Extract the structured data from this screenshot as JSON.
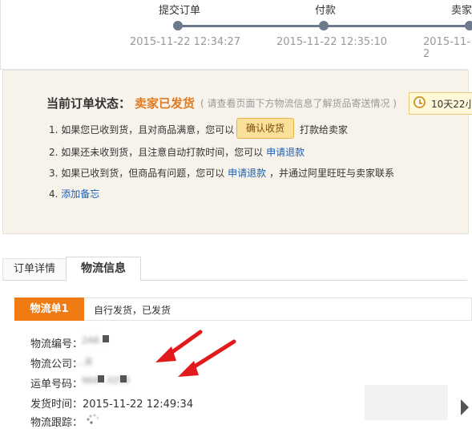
{
  "progress": {
    "steps": [
      {
        "label": "提交订单",
        "time": "2015-11-22 12:34:27"
      },
      {
        "label": "付款",
        "time": "2015-11-22 12:35:10"
      },
      {
        "label": "卖家",
        "time": "2015-11-2"
      }
    ]
  },
  "status": {
    "title": "当前订单状态：",
    "value": "卖家已发货",
    "hint": "( 请查看页面下方物流信息了解货品寄送情况 )",
    "countdown": "10天22小",
    "lines": {
      "l1_prefix": "1. 如果您已收到货，且对商品满意，您可以",
      "confirm_button": "确认收货",
      "l1_suffix": "打款给卖家",
      "l2_prefix": "2. 如果还未收到货，且注意自动打款时间，您可以",
      "l2_link": "申请退款",
      "l3_prefix": "3. 如果已收到货，但商品有问题，您可以",
      "l3_link": "申请退款",
      "l3_suffix": "，并通过阿里旺旺与卖家联系",
      "l4_prefix": "4.",
      "l4_link": "添加备忘"
    }
  },
  "tabs": {
    "order_detail": "订单详情",
    "logistics": "物流信息"
  },
  "logistics": {
    "badge": "物流单1",
    "status": "自行发货，已发货",
    "fields": {
      "number_label": "物流编号：",
      "number_value": "2A8…",
      "company_label": "物流公司：",
      "company_value": "…天",
      "tracking_label": "运单号码：",
      "tracking_value": "968…0250",
      "ship_time_label": "发货时间：",
      "ship_time_value": "2015-11-22 12:49:34",
      "trace_label": "物流跟踪："
    }
  },
  "icons": {
    "clock": "clock-icon",
    "spinner": "loading-spinner-icon",
    "arrows": "red-annotation-arrow-icon",
    "scroll": "scroll-right-arrow-icon"
  },
  "colors": {
    "accent": "#e07a1f",
    "badge": "#f07b12",
    "link": "#1a5fb4",
    "arrow": "#e11b1b"
  }
}
